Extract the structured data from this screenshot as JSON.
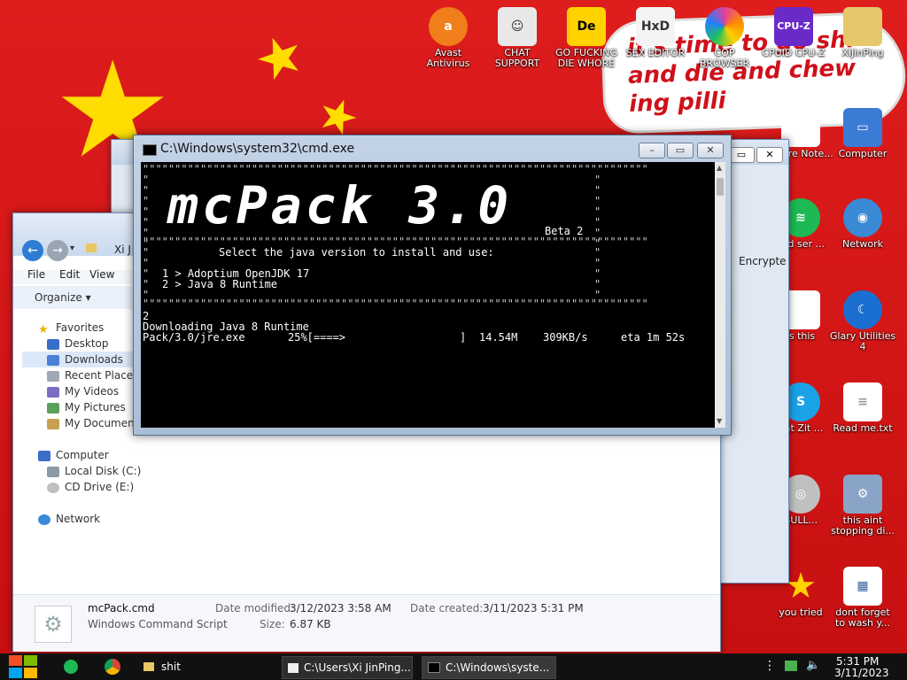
{
  "desktop": {
    "icons": [
      {
        "label": "Avast Antivirus",
        "icon": "avast-icon",
        "color": "#f07e1a"
      },
      {
        "label": "CHAT SUPPORT",
        "icon": "support-agent-icon",
        "color": "#ffffff"
      },
      {
        "label": "GO FUCKING DIE WHORE",
        "icon": "die-icon",
        "color": "#ffd200"
      },
      {
        "label": "SEX EDITOR",
        "icon": "hex-editor-icon",
        "color": "#f4f4f4"
      },
      {
        "label": "COP BROWSER",
        "icon": "browser-icon",
        "color": "#e040a0"
      },
      {
        "label": "CPUID CPU-Z",
        "icon": "cpuz-icon",
        "color": "#6a2ac8"
      },
      {
        "label": "XiJinPing",
        "icon": "user-folder-icon",
        "color": "#e6c86a"
      },
      {
        "label": "Computer",
        "icon": "computer-icon",
        "color": "#3a7bd5"
      },
      {
        "label": "eware Note...",
        "icon": "notepad-icon",
        "color": "#ffffff"
      },
      {
        "label": "Network",
        "icon": "network-icon",
        "color": "#3a8ad5"
      },
      {
        "label": "sed ser ...",
        "icon": "spotify-icon",
        "color": "#1db954"
      },
      {
        "label": "Glary Utilities 4",
        "icon": "glary-icon",
        "color": "#1a6fd0"
      },
      {
        "label": "is this",
        "icon": "document-icon",
        "color": "#ffffff"
      },
      {
        "label": "hat Zit ...",
        "icon": "skype-icon",
        "color": "#1ba2e6"
      },
      {
        "label": "Read me.txt",
        "icon": "text-file-icon",
        "color": "#ffffff"
      },
      {
        "label": "BULL...",
        "icon": "disc-icon",
        "color": "#c0c0c0"
      },
      {
        "label": "this aint stopping di...",
        "icon": "tools-icon",
        "color": "#8aa4c8"
      },
      {
        "label": "you tried",
        "icon": "star-icon",
        "color": "#ffd200"
      },
      {
        "label": "dont forget to wash y...",
        "icon": "calendar-doc-icon",
        "color": "#ffffff"
      }
    ],
    "banner_text": "it's time to go shi and die and chew ing pilli"
  },
  "explorer": {
    "address": "Xi J",
    "menu": [
      "File",
      "Edit",
      "View"
    ],
    "organize": "Organize",
    "nav": {
      "favorites": "Favorites",
      "fav_items": [
        "Desktop",
        "Downloads",
        "Recent Places",
        "My Videos",
        "My Pictures",
        "My Documents"
      ],
      "computer": "Computer",
      "drives": [
        "Local Disk (C:)",
        "CD Drive (E:)"
      ],
      "network": "Network"
    },
    "details": {
      "filename": "mcPack.cmd",
      "filetype": "Windows Command Script",
      "modified_label": "Date modified:",
      "modified": "3/12/2023 3:58 AM",
      "created_label": "Date created:",
      "created": "3/11/2023 5:31 PM",
      "size_label": "Size:",
      "size": "6.87 KB"
    }
  },
  "backwin": {
    "column": "Encrypte"
  },
  "cmd": {
    "title": "C:\\Windows\\system32\\cmd.exe",
    "logo": "mcPack 3.0",
    "version": "Beta 2",
    "prompt": "Select the java version to install and use:",
    "option1": "1 > Adoptium OpenJDK 17",
    "option2": "2 > Java 8 Runtime",
    "input": "2",
    "status": "Downloading Java 8 Runtime",
    "progress_file": "Pack/3.0/jre.exe",
    "progress_pct": "25%[====>",
    "progress_end": "]",
    "progress_size": "14.54M",
    "progress_speed": "309KB/s",
    "progress_eta": "eta 1m 52s",
    "progress": 0.25
  },
  "taskbar": {
    "items": [
      "shit",
      "C:\\Users\\Xi JinPing...",
      "C:\\Windows\\syste..."
    ],
    "time": "5:31 PM",
    "date": "3/11/2023"
  }
}
